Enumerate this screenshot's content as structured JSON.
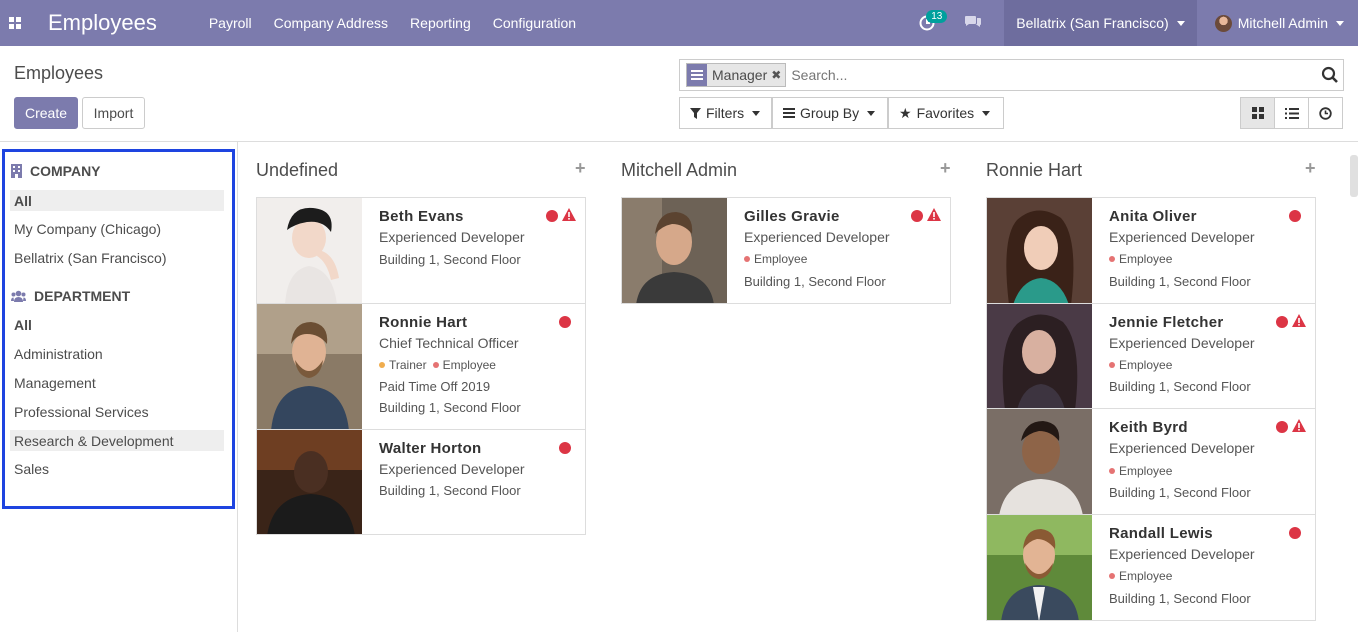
{
  "navbar": {
    "app_title": "Employees",
    "menu": [
      "Payroll",
      "Company Address",
      "Reporting",
      "Configuration"
    ],
    "activity_badge": "13",
    "company": "Bellatrix (San Francisco)",
    "user": "Mitchell Admin"
  },
  "control_panel": {
    "breadcrumb": "Employees",
    "create_label": "Create",
    "import_label": "Import",
    "facet_value": "Manager",
    "search_placeholder": "Search...",
    "filters_label": "Filters",
    "groupby_label": "Group By",
    "favorites_label": "Favorites"
  },
  "sidebar": {
    "company_header": "COMPANY",
    "company_items": [
      "All",
      "My Company (Chicago)",
      "Bellatrix (San Francisco)"
    ],
    "department_header": "DEPARTMENT",
    "department_items": [
      "All",
      "Administration",
      "Management",
      "Professional Services",
      "Research & Development",
      "Sales"
    ]
  },
  "columns": [
    {
      "title": "Undefined",
      "cards": [
        {
          "name": "Beth Evans",
          "job": "Experienced Developer",
          "tags": [],
          "extra": "",
          "location": "Building 1, Second Floor",
          "warning": true
        },
        {
          "name": "Ronnie Hart",
          "job": "Chief Technical Officer",
          "tags": [
            "Trainer",
            "Employee"
          ],
          "extra": "Paid Time Off 2019",
          "location": "Building 1, Second Floor",
          "warning": false
        },
        {
          "name": "Walter Horton",
          "job": "Experienced Developer",
          "tags": [],
          "extra": "",
          "location": "Building 1, Second Floor",
          "warning": false
        }
      ]
    },
    {
      "title": "Mitchell Admin",
      "cards": [
        {
          "name": "Gilles Gravie",
          "job": "Experienced Developer",
          "tags": [
            "Employee"
          ],
          "extra": "",
          "location": "Building 1, Second Floor",
          "warning": true
        }
      ]
    },
    {
      "title": "Ronnie Hart",
      "cards": [
        {
          "name": "Anita Oliver",
          "job": "Experienced Developer",
          "tags": [
            "Employee"
          ],
          "extra": "",
          "location": "Building 1, Second Floor",
          "warning": false
        },
        {
          "name": "Jennie Fletcher",
          "job": "Experienced Developer",
          "tags": [
            "Employee"
          ],
          "extra": "",
          "location": "Building 1, Second Floor",
          "warning": true
        },
        {
          "name": "Keith Byrd",
          "job": "Experienced Developer",
          "tags": [
            "Employee"
          ],
          "extra": "",
          "location": "Building 1, Second Floor",
          "warning": true
        },
        {
          "name": "Randall Lewis",
          "job": "Experienced Developer",
          "tags": [
            "Employee"
          ],
          "extra": "",
          "location": "Building 1, Second Floor",
          "warning": false
        }
      ]
    }
  ],
  "colors": {
    "brand": "#7c7bad",
    "status_red": "#dc3545",
    "tag_trainer": "#f0ad4e",
    "tag_employee": "#e57373",
    "highlight_border": "#1e44e0"
  }
}
